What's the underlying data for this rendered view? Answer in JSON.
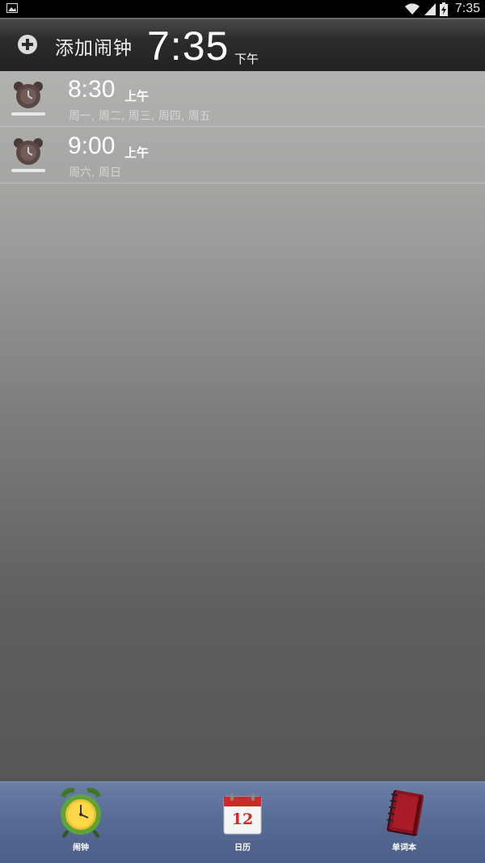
{
  "status_bar": {
    "time": "7:35"
  },
  "header": {
    "add_label": "添加闹钟",
    "current_time": "7:35",
    "current_ampm": "下午"
  },
  "alarms": [
    {
      "time": "8:30",
      "ampm": "上午",
      "days": "周一, 周二, 周三, 周四, 周五"
    },
    {
      "time": "9:00",
      "ampm": "上午",
      "days": "周六, 周日"
    }
  ],
  "bottom_nav": [
    {
      "label": "闹钟",
      "icon": "alarm-clock-icon"
    },
    {
      "label": "日历",
      "icon": "calendar-icon",
      "calendar_day": "12"
    },
    {
      "label": "单词本",
      "icon": "notebook-icon"
    }
  ],
  "colors": {
    "header_bg": "#2b2b2b",
    "nav_bg": "#566a94",
    "calendar_red": "#d32626",
    "notebook_red": "#8b1420"
  }
}
